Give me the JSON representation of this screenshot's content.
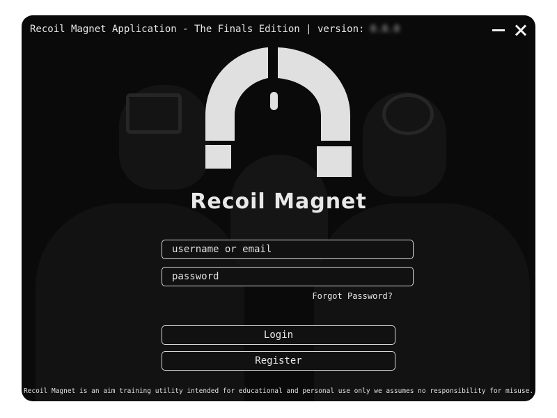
{
  "window": {
    "title": "Recoil Magnet Application - The Finals Edition | version: ",
    "version_value": "0.0.0"
  },
  "app": {
    "name": "Recoil Magnet"
  },
  "form": {
    "username_placeholder": "username or email",
    "password_placeholder": "password",
    "forgot_password": "Forgot Password?",
    "login_label": "Login",
    "register_label": "Register"
  },
  "footer": {
    "disclaimer": "Recoil Magnet is an aim training utility intended for educational and personal use only we assumes no responsibility for misuse."
  },
  "colors": {
    "background": "#0a0a0a",
    "foreground": "#e6e6e6",
    "logo": "#e0e0e0"
  },
  "icons": {
    "logo": "magnet-mouse-logo",
    "minimize": "minimize-icon",
    "close": "close-icon"
  }
}
